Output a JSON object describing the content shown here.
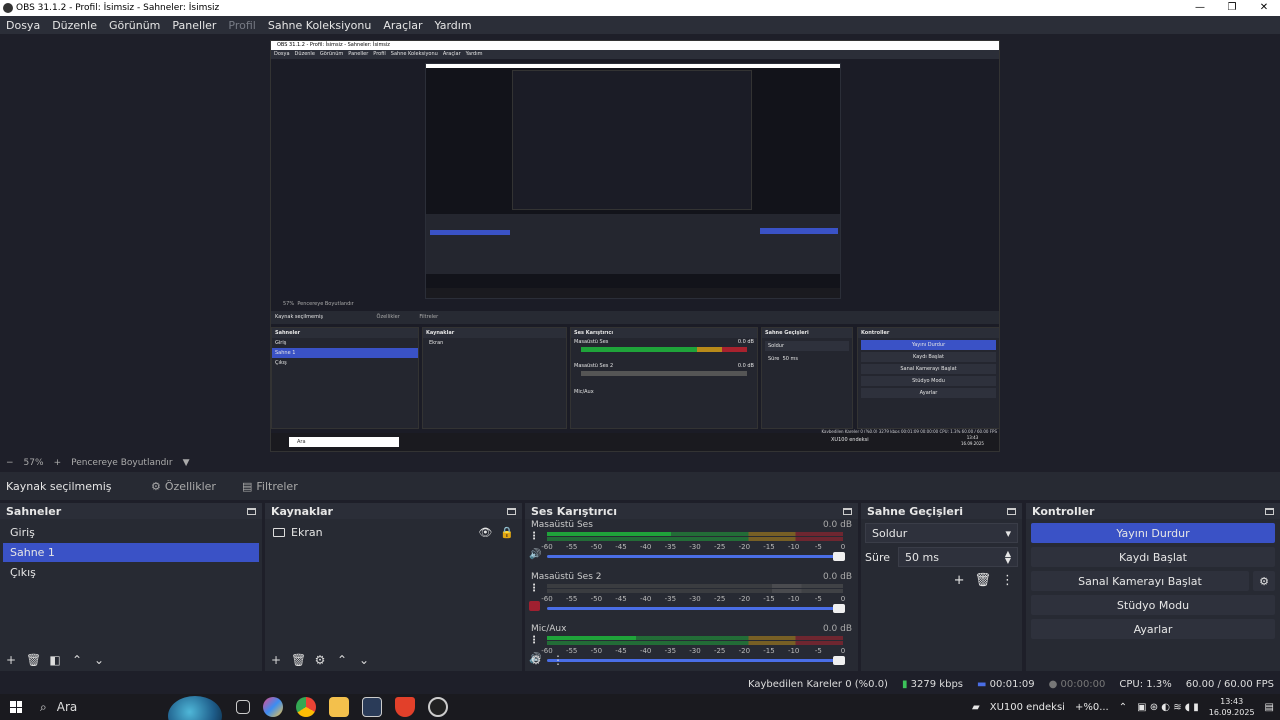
{
  "window": {
    "title": "OBS 31.1.2 - Profil: İsimsiz - Sahneler: İsimsiz",
    "controls": [
      "—",
      "❐",
      "✕"
    ]
  },
  "menu": [
    "Dosya",
    "Düzenle",
    "Görünüm",
    "Paneller",
    "Profil",
    "Sahne Koleksiyonu",
    "Araçlar",
    "Yardım"
  ],
  "zoom": {
    "minus": "−",
    "level": "57%",
    "plus": "+",
    "mode": "Pencereye Boyutlandır",
    "caret": "▼"
  },
  "selection": {
    "label": "Kaynak seçilmemiş",
    "properties": "Özellikler",
    "filters": "Filtreler"
  },
  "scenes": {
    "title": "Sahneler",
    "items": [
      "Giriş",
      "Sahne 1",
      "Çıkış"
    ],
    "selected_index": 1
  },
  "sources": {
    "title": "Kaynaklar",
    "items": [
      {
        "name": "Ekran"
      }
    ]
  },
  "mixer": {
    "title": "Ses Karıştırıcı",
    "channels": [
      {
        "name": "Masaüstü Ses",
        "db": "0.0 dB",
        "muted": false,
        "level": 0.42
      },
      {
        "name": "Masaüstü Ses 2",
        "db": "0.0 dB",
        "muted": true,
        "level": 0.0
      },
      {
        "name": "Mic/Aux",
        "db": "0.0 dB",
        "muted": false,
        "level": 0.3
      }
    ],
    "ticks": [
      "-60",
      "-55",
      "-50",
      "-45",
      "-40",
      "-35",
      "-30",
      "-25",
      "-20",
      "-15",
      "-10",
      "-5",
      "0"
    ]
  },
  "transitions": {
    "title": "Sahne Geçişleri",
    "selected": "Soldur",
    "duration_label": "Süre",
    "duration_value": "50 ms"
  },
  "controls": {
    "title": "Kontroller",
    "stop_stream": "Yayını Durdur",
    "start_record": "Kaydı Başlat",
    "virtual_cam": "Sanal Kamerayı Başlat",
    "studio_mode": "Stüdyo Modu",
    "settings": "Ayarlar"
  },
  "status": {
    "dropped": "Kaybedilen Kareler 0 (%0.0)",
    "bitrate": "3279 kbps",
    "stream_time": "00:01:09",
    "record_time": "00:00:00",
    "cpu": "CPU: 1.3%",
    "fps": "60.00 / 60.00 FPS"
  },
  "taskbar": {
    "search_placeholder": "Ara",
    "stock": "XU100 endeksi",
    "stock_change": "+%0...",
    "time": "13:43",
    "date": "16.09.2025"
  },
  "nested": {
    "title": "OBS 31.1.2 - Profil: İsimsiz - Sahneler: İsimsiz",
    "menu": [
      "Dosya",
      "Düzenle",
      "Görünüm",
      "Paneller",
      "Profil",
      "Sahne Koleksiyonu",
      "Araçlar",
      "Yardım"
    ],
    "no_source": "Kaynak seçilmemiş",
    "scenes": [
      "Giriş",
      "Sahne 1",
      "Çıkış"
    ],
    "source": "Ekran",
    "zoom": "57%",
    "zoom_mode": "Pencereye Boyutlandır",
    "properties": "Özellikler",
    "filters": "Filtreler",
    "panel_scenes": "Sahneler",
    "panel_sources": "Kaynaklar",
    "panel_mixer": "Ses Karıştırıcı",
    "panel_trans": "Sahne Geçişleri",
    "panel_controls": "Kontroller",
    "mixer_ch1": "Masaüstü Ses",
    "mixer_ch2": "Masaüstü Ses 2",
    "mixer_ch3": "Mic/Aux",
    "mixer_db": "0.0 dB",
    "trans_selected": "Soldur",
    "duration_label": "Süre",
    "duration_value": "50 ms",
    "stop_stream": "Yayını Durdur",
    "start_record": "Kaydı Başlat",
    "virtual_cam": "Sanal Kamerayı Başlat",
    "studio_mode": "Stüdyo Modu",
    "settings": "Ayarlar",
    "dropped": "Kaybedilen Kareler 0 (%0.0)",
    "bitrate": "3279 kbps",
    "stream_time": "00:01:09",
    "record_time": "00:00:00",
    "cpu": "CPU: 1.3%",
    "fps": "60.00 / 60.00 FPS",
    "search": "Ara",
    "stock": "XU100 endeksi",
    "time": "13:43",
    "date": "16.09.2025"
  },
  "colors": {
    "accent": "#3a52c6",
    "meter_green": "#1fa33a",
    "meter_yellow": "#b88a1a",
    "meter_red": "#a8222e"
  }
}
